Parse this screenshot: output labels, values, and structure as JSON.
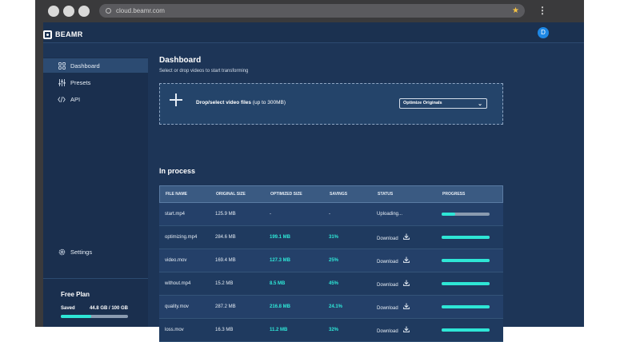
{
  "browser": {
    "url": "cloud.beamr.com"
  },
  "app": {
    "brand": "BEAMR",
    "avatar_initial": "D"
  },
  "sidebar": {
    "items": [
      {
        "label": "Dashboard",
        "icon": "grid-icon",
        "active": true
      },
      {
        "label": "Presets",
        "icon": "sliders-icon",
        "active": false
      },
      {
        "label": "API",
        "icon": "code-icon",
        "active": false
      }
    ],
    "settings_label": "Settings",
    "plan": {
      "title": "Free Plan",
      "saved_label": "Saved",
      "saved_value": "44.8 GB / 100 GB",
      "saved_fraction": 0.448
    }
  },
  "dashboard": {
    "title": "Dashboard",
    "subtitle": "Select or drop videos to start transforming",
    "drop_label": "Drop/select video files",
    "drop_hint": " (up to 300MB)",
    "select_value": "Optimize Originals"
  },
  "in_process": {
    "title": "In process",
    "columns": [
      "FILE NAME",
      "ORIGINAL SIZE",
      "OPTIMIZED SIZE",
      "SAVINGS",
      "STATUS",
      "PROGRESS"
    ],
    "rows": [
      {
        "file": "start.mp4",
        "original": "125.9 MB",
        "optimized": "-",
        "savings": "-",
        "status": "Uploading...",
        "progress": 0.28
      },
      {
        "file": "optimizing.mp4",
        "original": "284.6 MB",
        "optimized": "199.1 MB",
        "savings": "31%",
        "status": "Download",
        "progress": 1.0
      },
      {
        "file": "video.mov",
        "original": "169.4 MB",
        "optimized": "127.3 MB",
        "savings": "25%",
        "status": "Download",
        "progress": 1.0
      },
      {
        "file": "without.mp4",
        "original": "15.2 MB",
        "optimized": "8.5 MB",
        "savings": "45%",
        "status": "Download",
        "progress": 1.0
      },
      {
        "file": "quality.mov",
        "original": "287.2 MB",
        "optimized": "216.8 MB",
        "savings": "24.1%",
        "status": "Download",
        "progress": 1.0
      },
      {
        "file": "loss.mov",
        "original": "16.3 MB",
        "optimized": "11.2 MB",
        "savings": "32%",
        "status": "Download",
        "progress": 1.0
      }
    ]
  },
  "colors": {
    "accent": "#2ee6d6",
    "background": "#1d3557",
    "avatar": "#1e88e5"
  }
}
